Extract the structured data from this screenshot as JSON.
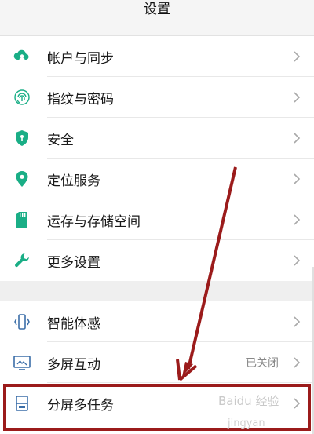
{
  "header": {
    "title": "设置"
  },
  "colors": {
    "accent": "#1aae86",
    "arrow": "#9b1b1b",
    "chevron": "#a9a9a9"
  },
  "group1": [
    {
      "label": "帐户与同步",
      "icon": "cloud-account-icon"
    },
    {
      "label": "指纹与密码",
      "icon": "fingerprint-icon"
    },
    {
      "label": "安全",
      "icon": "shield-icon"
    },
    {
      "label": "定位服务",
      "icon": "location-pin-icon"
    },
    {
      "label": "运存与存储空间",
      "icon": "sd-card-icon"
    },
    {
      "label": "更多设置",
      "icon": "wrench-icon"
    }
  ],
  "group2": [
    {
      "label": "智能体感",
      "icon": "phone-motion-icon",
      "value": ""
    },
    {
      "label": "多屏互动",
      "icon": "cast-screen-icon",
      "value": "已关闭"
    },
    {
      "label": "分屏多任务",
      "icon": "split-screen-icon",
      "value": ""
    }
  ],
  "watermark": {
    "text": "Baidu 经验",
    "subtext": "jingyan"
  }
}
